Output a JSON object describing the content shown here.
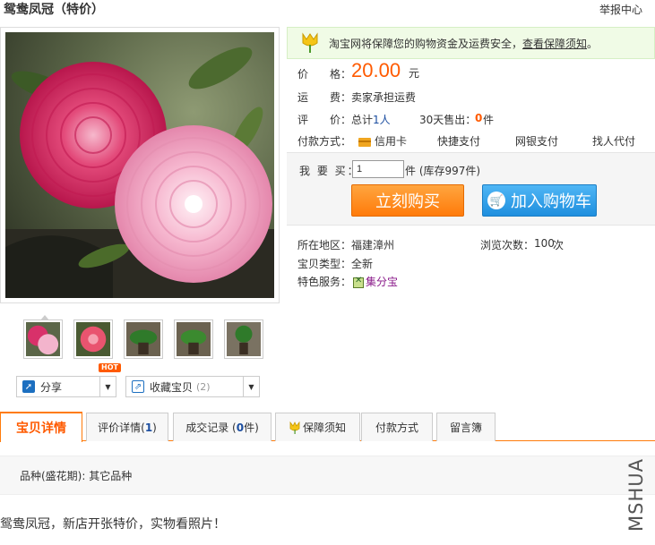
{
  "page": {
    "title": "鸳鸯凤冠（特价）",
    "report_link": "举报中心"
  },
  "guarantee": {
    "text": "淘宝网将保障您的购物资金及运费安全，",
    "link": "查看保障须知",
    "tail": "。"
  },
  "price_row": {
    "label": "价　　格：",
    "value": "20.00",
    "unit": "元"
  },
  "shipping_row": {
    "label": "运　　费：",
    "value": "卖家承担运费"
  },
  "review_row": {
    "label": "评　　价：",
    "total_prefix": "总计",
    "total_value": "1人",
    "sold_label": "30天售出：",
    "sold_value": "0",
    "sold_unit": "件"
  },
  "payment_row": {
    "label": "付款方式：",
    "options": [
      "信用卡",
      "快捷支付",
      "网银支付",
      "找人代付"
    ]
  },
  "purchase": {
    "qty_label": "我 要 买：",
    "qty_value": "1",
    "stock": "件 (库存997件)",
    "buy_now": "立刻购买",
    "add_cart": "加入购物车"
  },
  "details": {
    "location_label": "所在地区：",
    "location_value": "福建漳州",
    "views_label": "浏览次数：",
    "views_value": "100",
    "views_unit": "次",
    "condition_label": "宝贝类型：",
    "condition_value": "全新",
    "service_label": "特色服务：",
    "service_value": "集分宝"
  },
  "actions": {
    "share": "分享",
    "favorite": "收藏宝贝",
    "favorite_count": "(2)",
    "hot_badge": "HOT"
  },
  "tabs": [
    {
      "label": "宝贝详情"
    },
    {
      "label": "评价详情(",
      "count": "1",
      "suffix": ")"
    },
    {
      "label": "成交记录 (",
      "count": "0",
      "suffix": "件)"
    },
    {
      "label": "保障须知"
    },
    {
      "label": "付款方式"
    },
    {
      "label": "留言簿"
    }
  ],
  "attributes": {
    "variety": "品种(盛花期): 其它品种"
  },
  "description": "鸳鸯凤冠，新店开张特价，实物看照片！",
  "watermark": "MSHUA",
  "colors": {
    "accent": "#ff5a00",
    "link": "#1c4ea0",
    "buy": "#ff7b0a",
    "cart": "#1f8fde",
    "guarantee_bg": "#f0fbe6"
  },
  "icons": {
    "share": "share-icon",
    "favorite": "favorite-icon",
    "guarantee": "tulip-icon",
    "cart": "cart-icon",
    "credit_card": "credit-card-icon",
    "jifenbao": "jifenbao-icon"
  }
}
